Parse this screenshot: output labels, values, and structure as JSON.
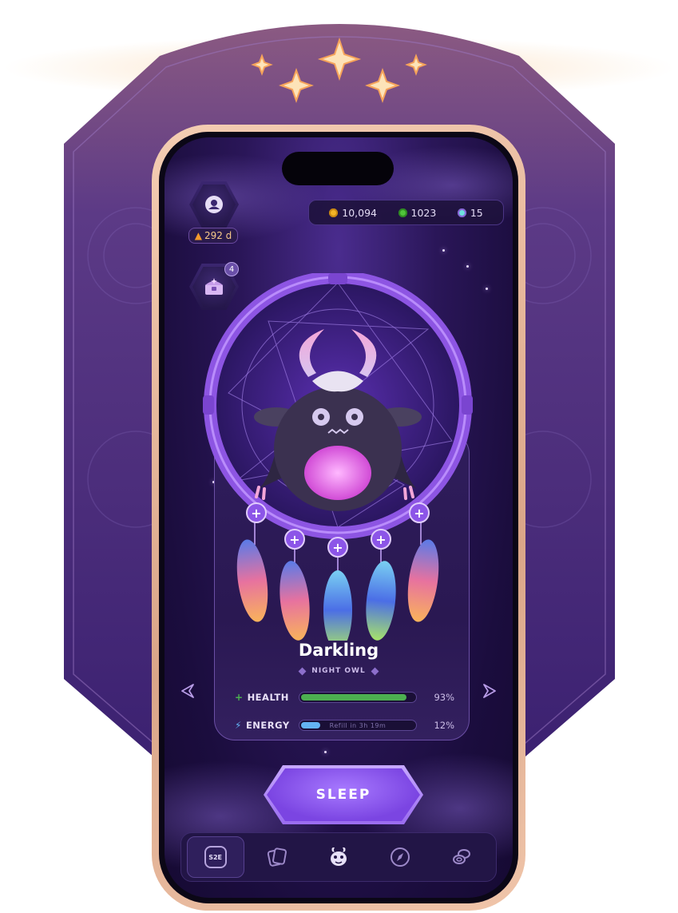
{
  "header": {
    "streak": "292 d",
    "chest_badge": "4",
    "currency": [
      {
        "icon": "gold-coin-icon",
        "value": "10,094",
        "color": "#f3b427"
      },
      {
        "icon": "green-gem-icon",
        "value": "1023",
        "color": "#4fc33a"
      },
      {
        "icon": "teal-token-icon",
        "value": "15",
        "color": "#6fe2e0"
      }
    ]
  },
  "creature": {
    "name": "Darkling",
    "subtitle": "NIGHT OWL"
  },
  "stats": {
    "health": {
      "label": "HEALTH",
      "value": "93%",
      "level": 0.93,
      "color": "#4caf50"
    },
    "energy": {
      "label": "ENERGY",
      "value": "12%",
      "level": 0.12,
      "color": "#63b3f2",
      "bar_text": "Refill in 3h 19m"
    }
  },
  "actions": {
    "sleep_label": "SLEEP"
  },
  "nav": {
    "items": [
      {
        "icon": "s2e-icon",
        "label": "S2E",
        "active": true
      },
      {
        "icon": "cards-icon",
        "active": false
      },
      {
        "icon": "creature-icon",
        "active": false
      },
      {
        "icon": "compass-icon",
        "active": false
      },
      {
        "icon": "coins-icon",
        "active": false
      }
    ]
  }
}
